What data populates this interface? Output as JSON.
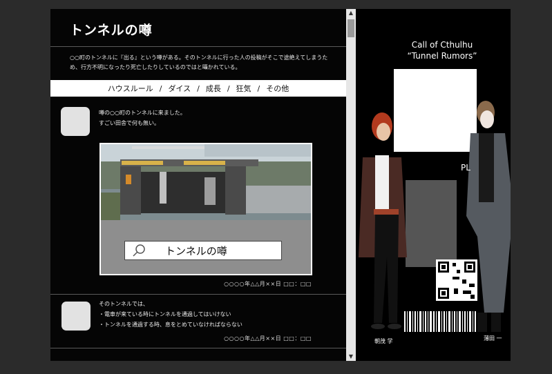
{
  "page": {
    "title": "トンネルの噂",
    "intro": "○○町のトンネルに『出る』という噂がある。そのトンネルに行った人の投稿がそこで途絶えてしまうため、行方不明になったり死亡したりしているのではと囁かれている。"
  },
  "tabs": [
    {
      "label": "ハウスルール"
    },
    {
      "label": "ダイス"
    },
    {
      "label": "成長"
    },
    {
      "label": "狂気"
    },
    {
      "label": "その他"
    }
  ],
  "tab_separator": "/",
  "posts": [
    {
      "lines": [
        "噂の○○町のトンネルに来ました。",
        "すごい田舎で何も無い。"
      ],
      "image_search_label": "トンネルの噂",
      "timestamp": "○○○○年△△月××日 □□：□□"
    },
    {
      "lines": [
        "そのトンネルでは、",
        "・電車が来ている時にトンネルを通過してはいけない",
        "・トンネルを通過する時、息をとめていなければならない"
      ],
      "timestamp": "○○○○年△△月××日 □□：□□"
    }
  ],
  "scrollbar": {
    "up": "▲",
    "down": "▼"
  },
  "cover": {
    "title_line1": "Call of Cthulhu",
    "title_line2": "“Tunnel Rumors”",
    "pl_label": "PL",
    "character1_name": "朝茂 学",
    "character2_name": "薄田 一"
  },
  "colors": {
    "background": "#2b2b2b",
    "panel": "#050505",
    "tab_bar": "#ffffff"
  },
  "icons": {
    "search": "magnifier-icon"
  }
}
